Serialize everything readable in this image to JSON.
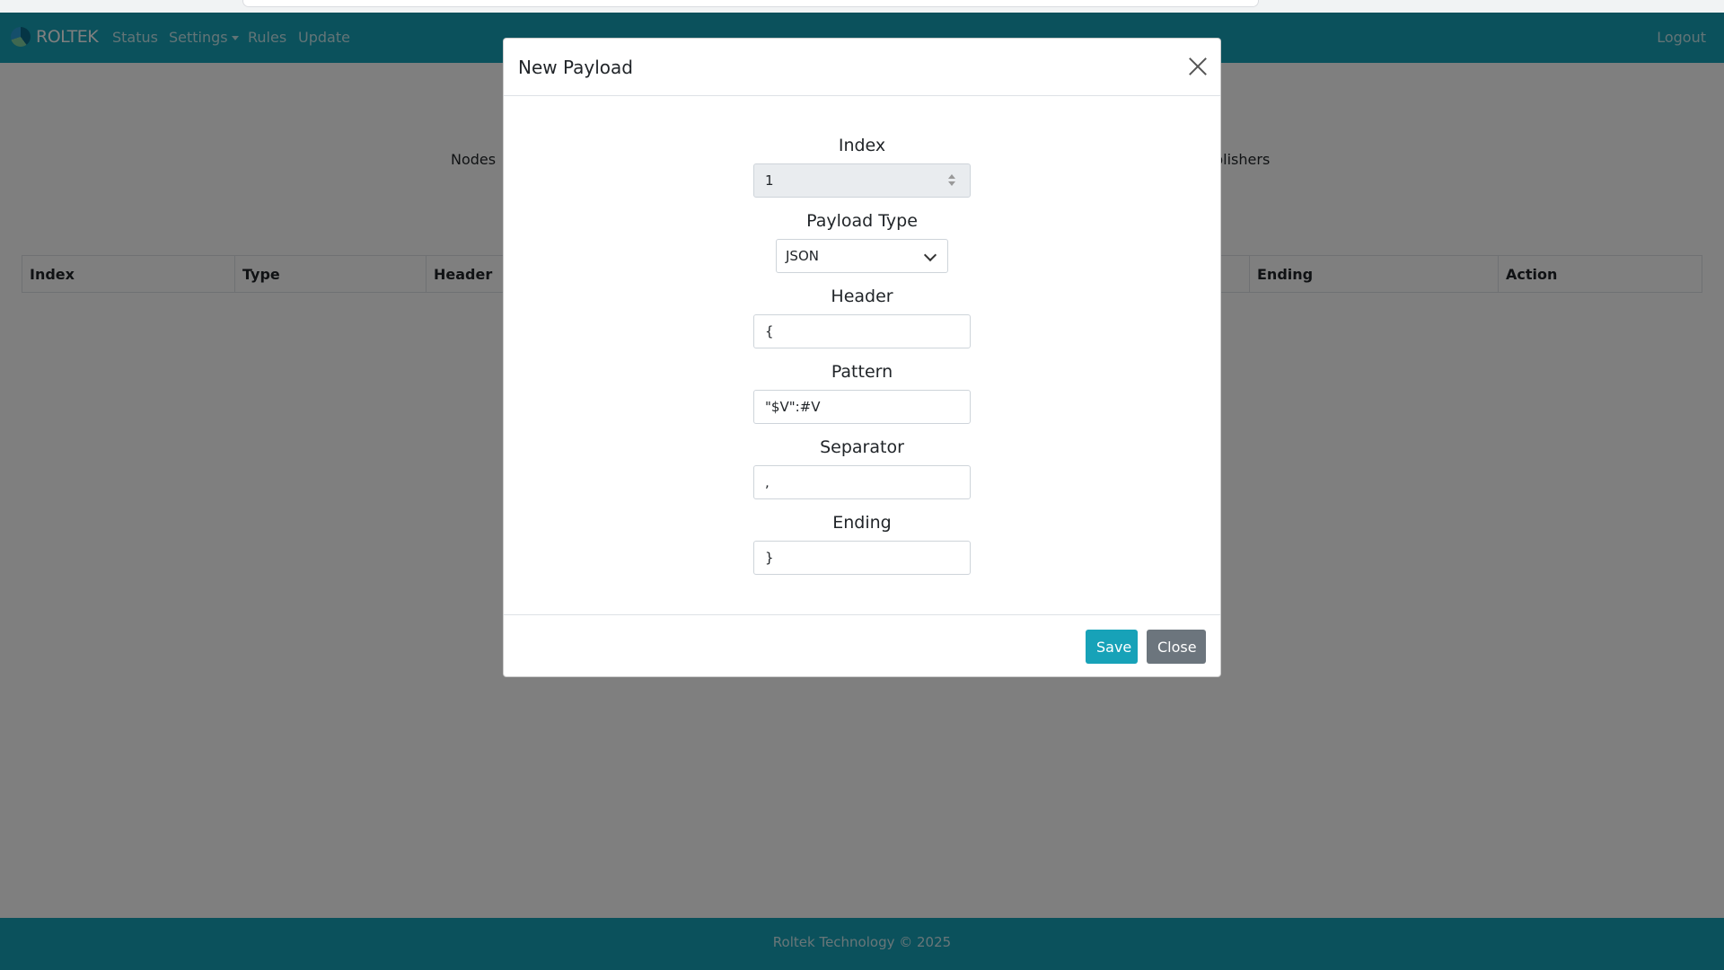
{
  "navbar": {
    "brand": "ROLTEK",
    "items": [
      "Status",
      "Settings",
      "Rules",
      "Update"
    ],
    "logout": "Logout"
  },
  "subnav": {
    "left": "Nodes",
    "right": "blishers"
  },
  "table": {
    "headers": [
      "Index",
      "Type",
      "Header",
      "Ending",
      "Action"
    ]
  },
  "footer": {
    "text": "Roltek Technology © 2025"
  },
  "modal": {
    "title": "New Payload",
    "fields": {
      "index": {
        "label": "Index",
        "value": "1"
      },
      "payload_type": {
        "label": "Payload Type",
        "value": "JSON"
      },
      "header": {
        "label": "Header",
        "value": "{"
      },
      "pattern": {
        "label": "Pattern",
        "value": "\"$V\":#V"
      },
      "separator": {
        "label": "Separator",
        "value": ","
      },
      "ending": {
        "label": "Ending",
        "value": "}"
      }
    },
    "buttons": {
      "save": "Save",
      "close": "Close"
    }
  },
  "colors": {
    "primary": "#17a2b8",
    "secondary": "#6c757d",
    "backdrop": "rgba(0,0,0,0.5)"
  }
}
